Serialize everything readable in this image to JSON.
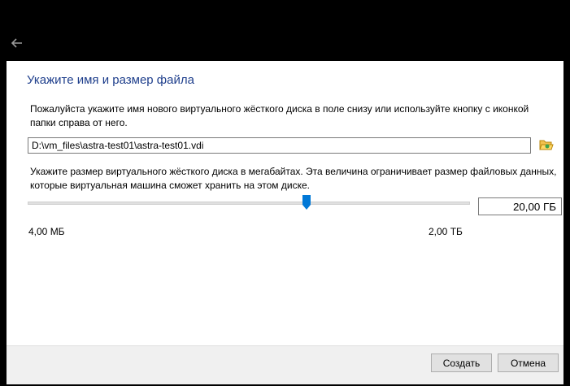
{
  "dialog": {
    "back_icon": "arrow-left-icon",
    "heading": "Укажите имя и размер файла",
    "intro": "Пожалуйста укажите имя нового виртуального жёсткого диска в поле снизу или используйте кнопку с иконкой папки справа от него.",
    "file_path": "D:\\vm_files\\astra-test01\\astra-test01.vdi",
    "folder_icon": "folder-open-icon",
    "size_description": "Укажите размер виртуального жёсткого диска в мегабайтах. Эта величина ограничивает размер файловых данных, которые виртуальная машина сможет хранить на этом диске.",
    "size": {
      "value_text": "20,00 ГБ",
      "min_label": "4,00 МБ",
      "max_label": "2,00 ТБ",
      "slider_fraction": 0.63
    },
    "buttons": {
      "create": "Создать",
      "cancel": "Отмена"
    }
  },
  "colors": {
    "heading": "#1f3f8c",
    "slider_thumb": "#0078d7",
    "titlebar": "#000000"
  }
}
